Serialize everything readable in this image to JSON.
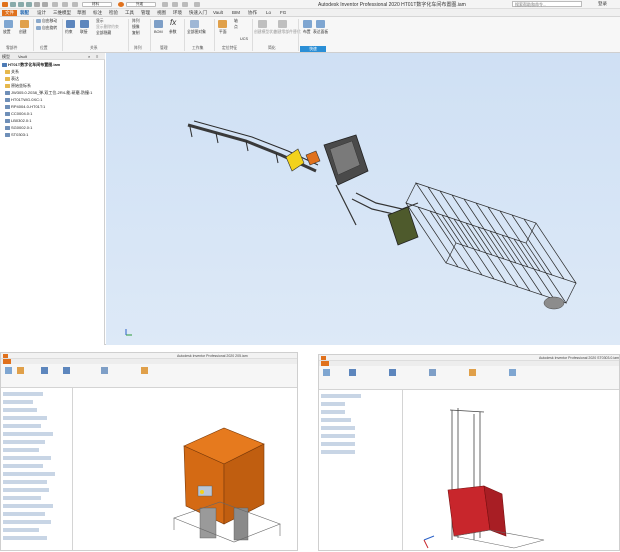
{
  "window": {
    "app_title": "Autodesk Inventor Professional 2020",
    "doc_title": "HT01T数字化车间布置图.iam",
    "title_full": "Autodesk Inventor Professional 2020    HT01T数字化车间布置图.iam",
    "search_placeholder": "搜索帮助和命令...",
    "login": "登录",
    "qat_material": "材料",
    "qat_appearance": "外观"
  },
  "tabs": [
    "文件",
    "装配",
    "设计",
    "三维模型",
    "草图",
    "标注",
    "检验",
    "工具",
    "管理",
    "视图",
    "环境",
    "快速入门",
    "Vault",
    "BIM",
    "协作",
    "Lo",
    "FG"
  ],
  "ribbon": {
    "buttons": [
      "放置",
      "创建",
      "自由移动",
      "自由旋转",
      "约束",
      "联接",
      "显示",
      "显示删除约束",
      "全部隐藏",
      "阵列",
      "镜像",
      "复制",
      "BOM",
      "参数",
      "全部图对象",
      "平面",
      "轴",
      "点",
      "UCS",
      "创建模型状态",
      "创建零部件替代",
      "布置",
      "表达面板"
    ],
    "groups": [
      "零部件",
      "位置",
      "关系",
      "阵列",
      "管理",
      "工作集",
      "定位特征",
      "简化",
      "快速"
    ]
  },
  "browser": {
    "tabs": [
      "模型",
      "Vault"
    ],
    "root": "HT01T数字化车间布置图.iam",
    "items": [
      {
        "icon": "folder",
        "label": "关系"
      },
      {
        "icon": "folder",
        "label": "表达"
      },
      {
        "icon": "folder",
        "label": "原始坐标系"
      },
      {
        "icon": "part",
        "label": "JW305.0.2038_弹-双工位-2R4-能-研磨-防撞:1"
      },
      {
        "icon": "part",
        "label": "HT01TWG.0XC:1"
      },
      {
        "icon": "part",
        "label": "RP4004.0-HT01T:1"
      },
      {
        "icon": "part",
        "label": "CC0004.0:1"
      },
      {
        "icon": "part",
        "label": "LB0302.0:1"
      },
      {
        "icon": "part",
        "label": "SG0002.0:1"
      },
      {
        "icon": "part",
        "label": "ST0303:1"
      }
    ]
  },
  "sub_windows": [
    {
      "title": "Autodesk Inventor Professional 2020    205.iam"
    },
    {
      "title": "Autodesk Inventor Professional 2020    ST0303.0.iam"
    }
  ],
  "colors": {
    "file_tab": "#e0711c",
    "machine_orange": "#e67a1e",
    "viewport_bg": "#d6e5f5",
    "quick_group": "#2b8fd6",
    "rack_red": "#c8262c"
  }
}
